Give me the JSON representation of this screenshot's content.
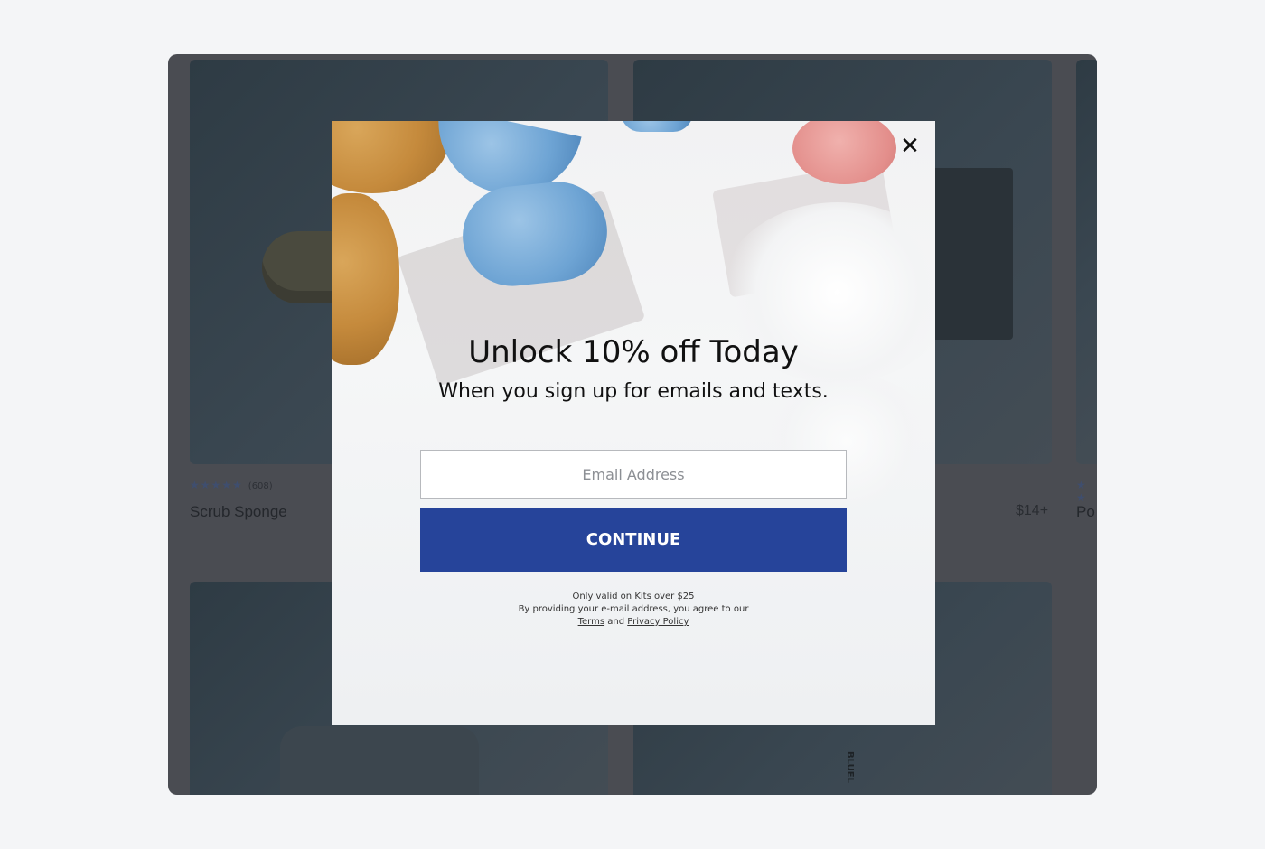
{
  "background_store": {
    "products": [
      {
        "rating_count": "(608)",
        "name": "Scrub Sponge",
        "price": ""
      },
      {
        "rating_count": "",
        "name": "",
        "price": "$14+"
      },
      {
        "rating_count": "",
        "name": "Po",
        "price": ""
      }
    ],
    "stars": "★★★★★",
    "stars_partial": "★ ★",
    "vertical_label": "BLUEL"
  },
  "modal": {
    "headline": "Unlock 10% off Today",
    "subline": "When you sign up for emails and texts.",
    "email_placeholder": "Email Address",
    "email_value": "",
    "continue_label": "CONTINUE",
    "fine_print": {
      "line1": "Only valid on Kits over $25",
      "line2": "By providing your e-mail address, you agree to our",
      "terms_label": "Terms",
      "and_text": "and",
      "privacy_label": "Privacy Policy"
    },
    "close_icon": "close-icon"
  },
  "colors": {
    "accent": "#26449a",
    "overlay": "#4a4c52",
    "page_bg": "#f4f5f7"
  }
}
